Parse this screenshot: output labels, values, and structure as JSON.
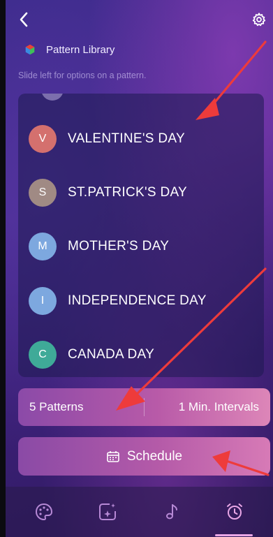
{
  "header": {
    "title": "Pattern Library",
    "hint": "Slide left for options on a pattern."
  },
  "patterns": [
    {
      "initial": "V",
      "name": "VALENTINE'S DAY",
      "color": "#d4706e"
    },
    {
      "initial": "S",
      "name": "ST.PATRICK'S DAY",
      "color": "#a08a84"
    },
    {
      "initial": "M",
      "name": "MOTHER'S DAY",
      "color": "#7da8df"
    },
    {
      "initial": "I",
      "name": "INDEPENDENCE DAY",
      "color": "#7da8df"
    },
    {
      "initial": "C",
      "name": "CANADA DAY",
      "color": "#3faa98"
    }
  ],
  "stats": {
    "patterns_label": "5 Patterns",
    "interval_label": "1 Min. Intervals"
  },
  "schedule": {
    "label": "Schedule"
  },
  "tabs": [
    {
      "icon": "palette-icon",
      "active": false
    },
    {
      "icon": "image-sparkle-icon",
      "active": false
    },
    {
      "icon": "music-note-icon",
      "active": false
    },
    {
      "icon": "alarm-clock-icon",
      "active": true
    }
  ],
  "colors": {
    "annotation_arrow": "#ee3b3b",
    "active_tab_underline": "#e9a7e6"
  }
}
